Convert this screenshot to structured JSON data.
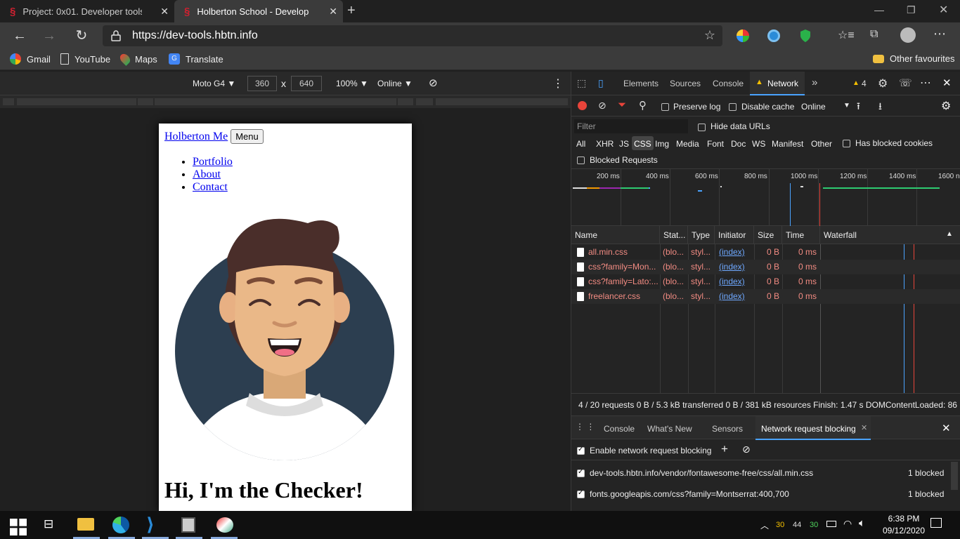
{
  "tabs": [
    {
      "title": "Project: 0x01. Developer tools | H",
      "active": false
    },
    {
      "title": "Holberton School - Developer to",
      "active": true
    }
  ],
  "address": {
    "url": "https://dev-tools.hbtn.info"
  },
  "bookmarks": [
    {
      "label": "Gmail",
      "icon": "google-icon"
    },
    {
      "label": "YouTube",
      "icon": "page-icon"
    },
    {
      "label": "Maps",
      "icon": "maps-pin-icon"
    },
    {
      "label": "Translate",
      "icon": "translate-icon"
    }
  ],
  "other_favourites": "Other favourites",
  "device_toolbar": {
    "device": "Moto G4 ▼",
    "width": "360",
    "times": "x",
    "height": "640",
    "zoom": "100% ▼",
    "network": "Online ▼"
  },
  "site": {
    "brand": "Holberton Me",
    "menu_button": "Menu",
    "nav": [
      "Portfolio",
      "About",
      "Contact"
    ],
    "heading": "Hi, I'm the Checker!"
  },
  "devtools": {
    "tabs": [
      "Elements",
      "Sources",
      "Console",
      "Network"
    ],
    "active_tab": "Network",
    "warnings": "4",
    "preserve_log": "Preserve log",
    "disable_cache": "Disable cache",
    "throttle": "Online",
    "filter_placeholder": "Filter",
    "hide_data_urls": "Hide data URLs",
    "types": [
      "All",
      "XHR",
      "JS",
      "CSS",
      "Img",
      "Media",
      "Font",
      "Doc",
      "WS",
      "Manifest",
      "Other"
    ],
    "active_type": "CSS",
    "has_blocked_cookies": "Has blocked cookies",
    "blocked_requests": "Blocked Requests",
    "timeline_ticks": [
      "200 ms",
      "400 ms",
      "600 ms",
      "800 ms",
      "1000 ms",
      "1200 ms",
      "1400 ms",
      "1600 n"
    ],
    "columns": [
      "Name",
      "Stat...",
      "Type",
      "Initiator",
      "Size",
      "Time",
      "Waterfall"
    ],
    "requests": [
      {
        "name": "all.min.css",
        "status": "(blo...",
        "type": "styl...",
        "initiator": "(index)",
        "size": "0 B",
        "time": "0 ms"
      },
      {
        "name": "css?family=Mon...",
        "status": "(blo...",
        "type": "styl...",
        "initiator": "(index)",
        "size": "0 B",
        "time": "0 ms"
      },
      {
        "name": "css?family=Lato:...",
        "status": "(blo...",
        "type": "styl...",
        "initiator": "(index)",
        "size": "0 B",
        "time": "0 ms"
      },
      {
        "name": "freelancer.css",
        "status": "(blo...",
        "type": "styl...",
        "initiator": "(index)",
        "size": "0 B",
        "time": "0 ms"
      }
    ],
    "status_bar": "4 / 20 requests  0 B / 5.3 kB transferred  0 B / 381 kB resources  Finish: 1.47 s  DOMContentLoaded: 86",
    "drawer_tabs": [
      "Console",
      "What's New",
      "Sensors",
      "Network request blocking"
    ],
    "drawer_active": "Network request blocking",
    "enable_blocking": "Enable network request blocking",
    "blocked_patterns": [
      {
        "pattern": "dev-tools.hbtn.info/vendor/fontawesome-free/css/all.min.css",
        "count": "1 blocked"
      },
      {
        "pattern": "fonts.googleapis.com/css?family=Montserrat:400,700",
        "count": "1 blocked"
      }
    ]
  },
  "taskbar": {
    "tray_nums": [
      "30",
      "44",
      "30"
    ],
    "time": "6:38 PM",
    "date": "09/12/2020"
  }
}
